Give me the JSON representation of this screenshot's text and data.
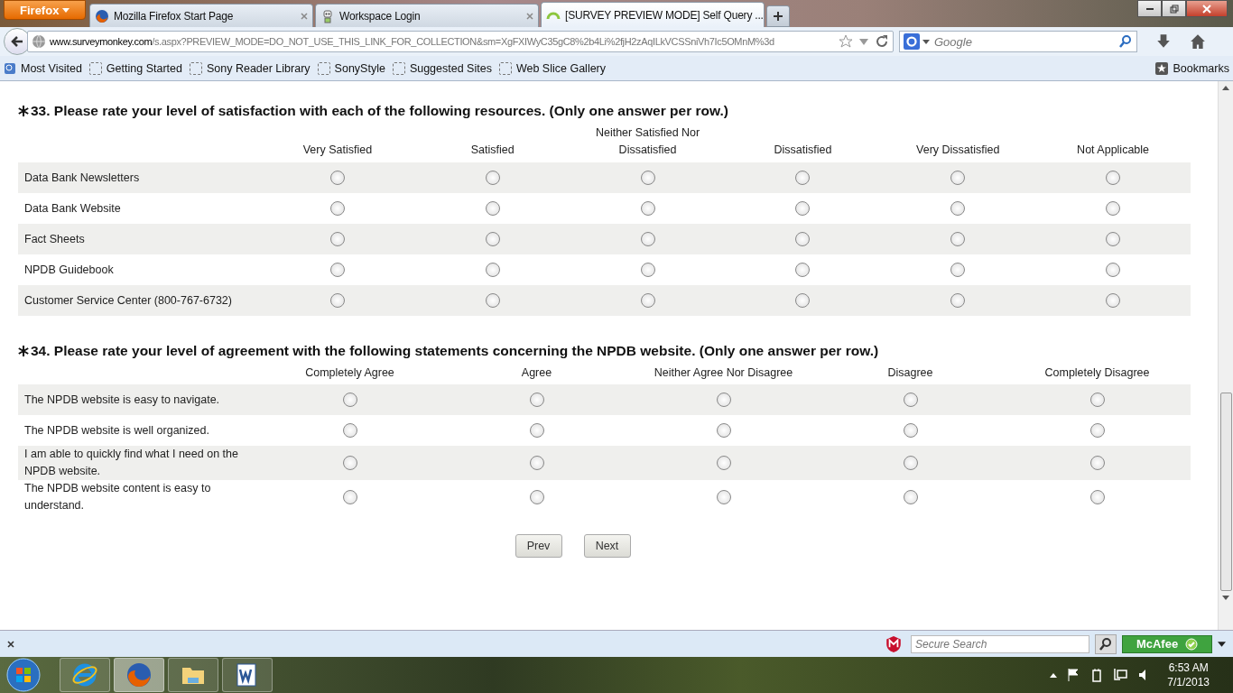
{
  "browser": {
    "menu_button": "Firefox",
    "tabs": [
      {
        "title": "Mozilla Firefox Start Page",
        "selected": false
      },
      {
        "title": "Workspace Login",
        "selected": false
      },
      {
        "title": "[SURVEY PREVIEW MODE] Self Query ...",
        "selected": true
      }
    ],
    "url_domain": "www.surveymonkey.com",
    "url_path": "/s.aspx?PREVIEW_MODE=DO_NOT_USE_THIS_LINK_FOR_COLLECTION&sm=XgFXIWyC35gC8%2b4Li%2fjH2zAqILkVCSSniVh7Ic5OMnM%3d",
    "search_placeholder": "Google",
    "bookmarks": [
      "Most Visited",
      "Getting Started",
      "Sony Reader Library",
      "SonyStyle",
      "Suggested Sites",
      "Web Slice Gallery"
    ],
    "bookmarks_menu": "Bookmarks"
  },
  "questions": [
    {
      "title": "33. Please rate your level of satisfaction with each of the following resources. (Only one answer per row.)",
      "required": true,
      "columns": [
        "Very Satisfied",
        "Satisfied",
        "Neither Satisfied Nor Dissatisfied",
        "Dissatisfied",
        "Very Dissatisfied",
        "Not Applicable"
      ],
      "rows": [
        {
          "label": "Data Bank Newsletters",
          "choices": [
            false,
            false,
            false,
            false,
            false,
            false
          ]
        },
        {
          "label": "Data Bank Website",
          "choices": [
            false,
            false,
            false,
            false,
            false,
            false
          ]
        },
        {
          "label": "Fact Sheets",
          "choices": [
            false,
            false,
            false,
            false,
            false,
            false
          ]
        },
        {
          "label": "NPDB Guidebook",
          "choices": [
            false,
            false,
            false,
            false,
            false,
            false
          ]
        },
        {
          "label": "Customer Service Center (800-767-6732)",
          "choices": [
            false,
            false,
            false,
            false,
            false,
            false
          ]
        }
      ]
    },
    {
      "title": "34. Please rate your level of agreement with the following statements concerning the NPDB website. (Only one answer per row.)",
      "required": true,
      "columns": [
        "Completely Agree",
        "Agree",
        "Neither Agree Nor Disagree",
        "Disagree",
        "Completely Disagree"
      ],
      "rows": [
        {
          "label": "The NPDB website is easy to navigate.",
          "choices": [
            false,
            false,
            false,
            false,
            false
          ]
        },
        {
          "label": "The NPDB website is well organized.",
          "choices": [
            false,
            false,
            false,
            false,
            false
          ]
        },
        {
          "label": "I am able to quickly find what I need on the NPDB website.",
          "choices": [
            false,
            false,
            false,
            false,
            false
          ]
        },
        {
          "label": "The NPDB website content is easy to understand.",
          "choices": [
            false,
            false,
            false,
            false,
            false
          ]
        }
      ]
    }
  ],
  "buttons": [
    "Prev",
    "Next"
  ],
  "addon_bar": {
    "search_placeholder": "Secure Search",
    "brand": "McAfee"
  },
  "taskbar": {
    "apps": [
      {
        "selected": false
      },
      {
        "selected": true
      },
      {
        "selected": false
      },
      {
        "selected": false
      }
    ],
    "time": "6:53 AM",
    "date": "7/1/2013"
  }
}
